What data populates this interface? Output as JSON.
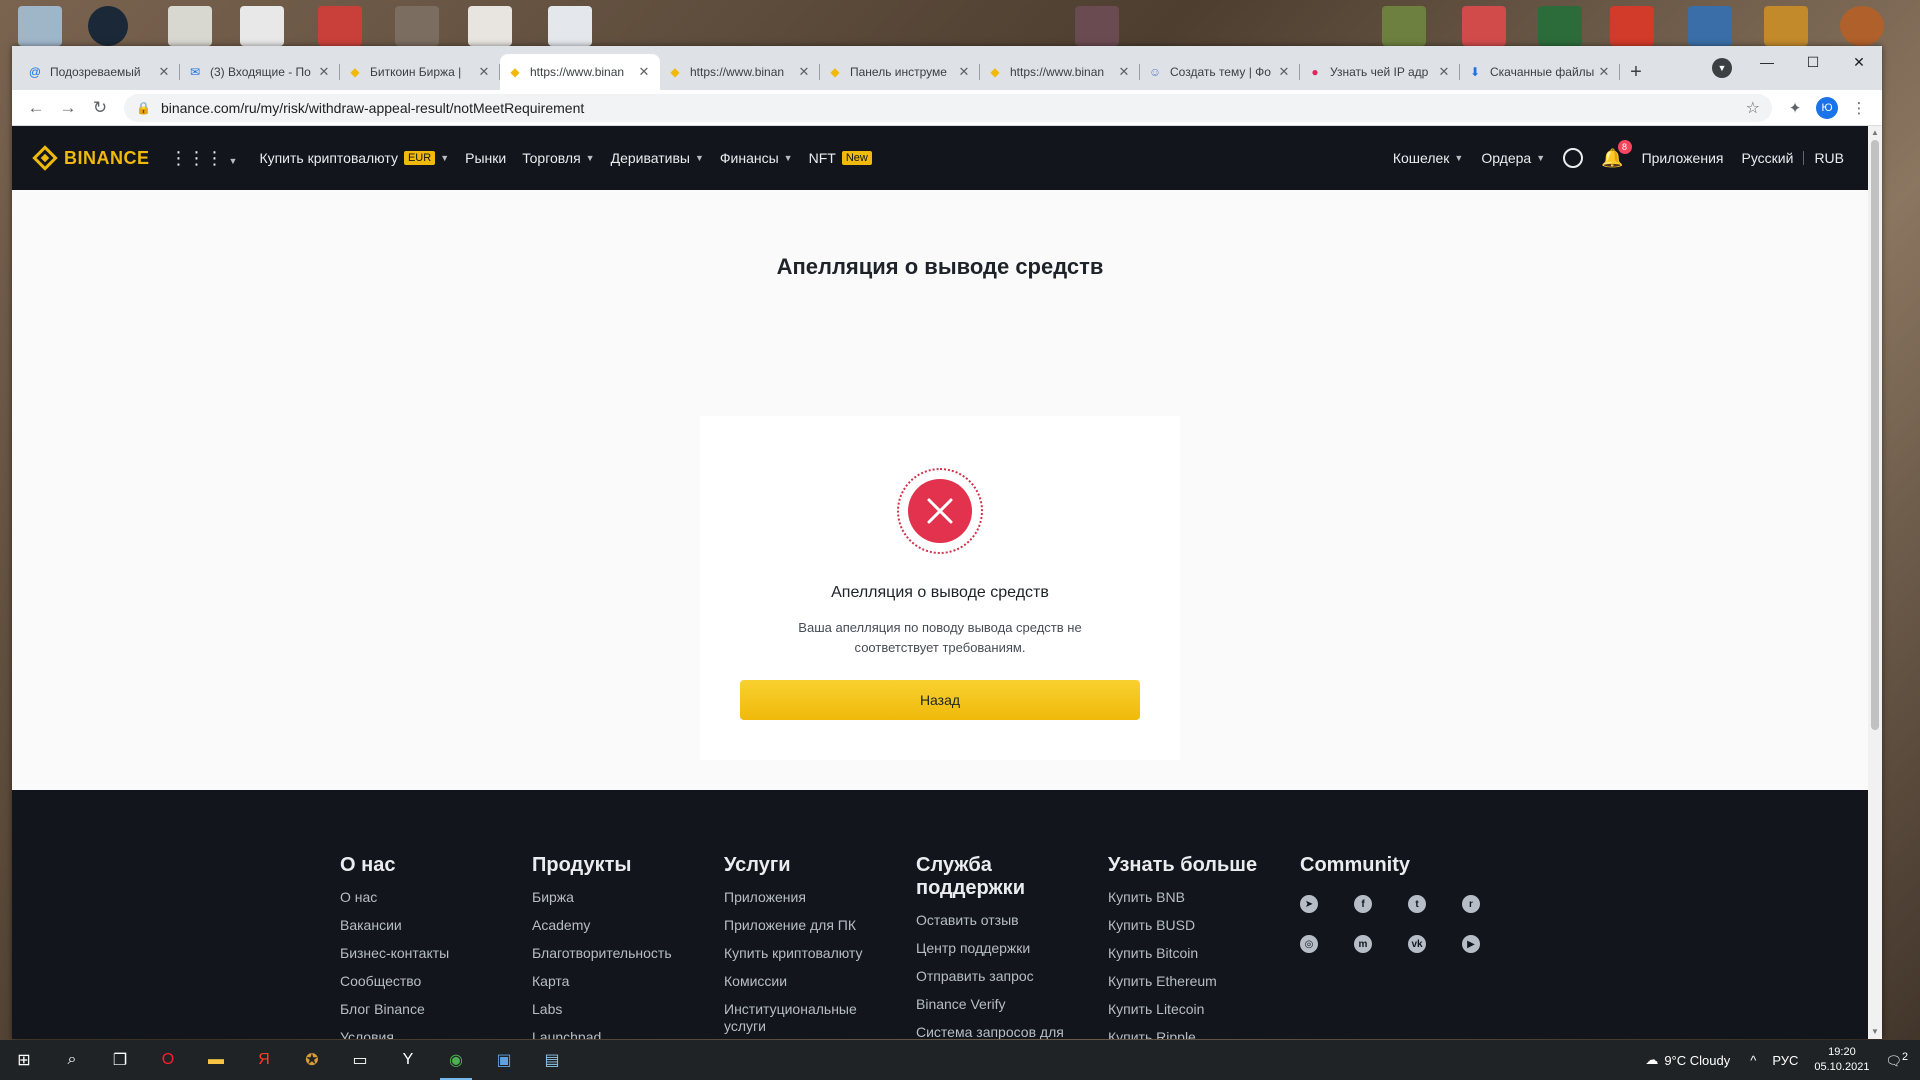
{
  "browser": {
    "tabs": [
      {
        "title": "Подозреваемый",
        "favicon": "at-icon",
        "active": false
      },
      {
        "title": "(3) Входящие - По",
        "favicon": "mail-icon",
        "active": false
      },
      {
        "title": "Биткоин Биржа |",
        "favicon": "binance-icon",
        "active": false
      },
      {
        "title": "https://www.binan",
        "favicon": "binance-icon",
        "active": true
      },
      {
        "title": "https://www.binan",
        "favicon": "binance-icon",
        "active": false
      },
      {
        "title": "Панель инструме",
        "favicon": "binance-icon",
        "active": false
      },
      {
        "title": "https://www.binan",
        "favicon": "binance-icon",
        "active": false
      },
      {
        "title": "Создать тему | Фо",
        "favicon": "forum-icon",
        "active": false
      },
      {
        "title": "Узнать чей IP адр",
        "favicon": "ip-icon",
        "active": false
      },
      {
        "title": "Скачанные файлы",
        "favicon": "download-icon",
        "active": false
      }
    ],
    "url": "binance.com/ru/my/risk/withdraw-appeal-result/notMeetRequirement",
    "profile_initial": "Ю"
  },
  "nav": {
    "logo": "BINANCE",
    "items": [
      {
        "label": "Купить криптовалюту",
        "badge": "EUR",
        "caret": true
      },
      {
        "label": "Рынки",
        "badge": "",
        "caret": false
      },
      {
        "label": "Торговля",
        "badge": "",
        "caret": true
      },
      {
        "label": "Деривативы",
        "badge": "",
        "caret": true
      },
      {
        "label": "Финансы",
        "badge": "",
        "caret": true
      },
      {
        "label": "NFT",
        "badge": "New",
        "caret": false
      }
    ],
    "wallet": "Кошелек",
    "orders": "Ордера",
    "notifications": "8",
    "apps": "Приложения",
    "language": "Русский",
    "currency": "RUB"
  },
  "main": {
    "title": "Апелляция о выводе средств",
    "card": {
      "title": "Апелляция о выводе средств",
      "message": "Ваша апелляция по поводу вывода средств не соответствует требованиям.",
      "button": "Назад"
    }
  },
  "footer": {
    "columns": [
      {
        "title": "О нас",
        "links": [
          "О нас",
          "Вакансии",
          "Бизнес-контакты",
          "Сообщество",
          "Блог Binance",
          "Условия"
        ]
      },
      {
        "title": "Продукты",
        "links": [
          "Биржа",
          "Academy",
          "Благотворительность",
          "Карта",
          "Labs",
          "Launchpad"
        ]
      },
      {
        "title": "Услуги",
        "links": [
          "Приложения",
          "Приложение для ПК",
          "Купить криптовалюту",
          "Комиссии",
          "Институциональные услуги"
        ]
      },
      {
        "title": "Служба поддержки",
        "links": [
          "Оставить отзыв",
          "Центр поддержки",
          "Отправить запрос",
          "Binance Verify",
          "Система запросов для"
        ]
      },
      {
        "title": "Узнать больше",
        "links": [
          "Купить BNB",
          "Купить BUSD",
          "Купить Bitcoin",
          "Купить Ethereum",
          "Купить Litecoin",
          "Купить Ripple"
        ]
      }
    ],
    "community": {
      "title": "Community",
      "icons": [
        "telegram-icon",
        "facebook-icon",
        "twitter-icon",
        "reddit-icon",
        "instagram-icon",
        "coinmarketcap-icon",
        "vk-icon",
        "youtube-icon"
      ]
    }
  },
  "taskbar": {
    "weather": "9°C  Cloudy",
    "lang": "РУС",
    "time": "19:20",
    "date": "05.10.2021",
    "notif_count": "2"
  },
  "colors": {
    "accent": "#f0b90b",
    "nav_bg": "#12161c",
    "error": "#e2324d"
  }
}
